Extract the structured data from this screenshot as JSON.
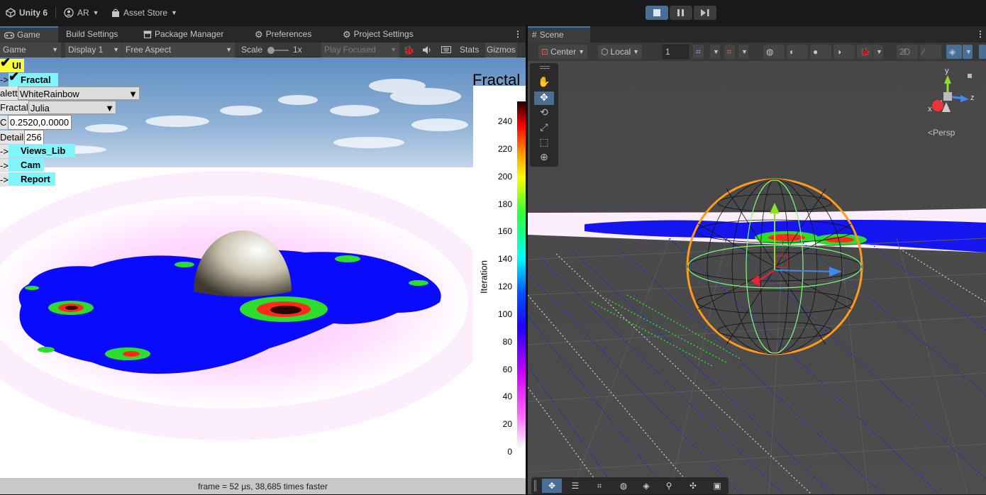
{
  "topbar": {
    "app_name": "Unity 6",
    "account": "AR",
    "asset_store": "Asset Store"
  },
  "game_tabs": [
    {
      "label": "Game"
    },
    {
      "label": "Build Settings"
    },
    {
      "label": "Package Manager"
    },
    {
      "label": "Preferences"
    },
    {
      "label": "Project Settings"
    }
  ],
  "game_toolbar": {
    "mode": "Game",
    "display": "Display 1",
    "aspect": "Free Aspect",
    "scale_label": "Scale",
    "scale_value": "1x",
    "play_mode": "Play Focused",
    "stats": "Stats",
    "gizmos": "Gizmos"
  },
  "overlay_ui": {
    "ui_toggle": "UI",
    "fractal_toggle": "Fractal",
    "palette_label": "alett",
    "palette_value": "WhiteRainbow",
    "fractal_label": "Fractal",
    "fractal_value": "Julia",
    "c_label": "C",
    "c_value": "0.2520,0.0000",
    "detail_label": "Detail",
    "detail_value": "256",
    "arrow": "->",
    "views_lib": "Views_Lib",
    "cam": "Cam",
    "report": "Report"
  },
  "colorbar": {
    "title": "Fractal",
    "axis_label": "Iteration",
    "ticks": [
      "240",
      "220",
      "200",
      "180",
      "160",
      "140",
      "120",
      "100",
      "80",
      "60",
      "40",
      "20",
      "0"
    ]
  },
  "status": {
    "text": "frame = 52 μs, 38,685 times faster"
  },
  "scene_tabs": [
    {
      "label": "Scene"
    }
  ],
  "scene_toolbar": {
    "pivot": "Center",
    "space": "Local",
    "grid_value": "1"
  },
  "gizmo": {
    "persp_label": "<Persp",
    "axis_x": "x",
    "axis_y": "y",
    "axis_z": "z"
  },
  "colors": {
    "accent": "#3a79bb",
    "cyan_label": "#7ff6fb",
    "yellow_label": "#ffff33",
    "fractal_blue": "#0a0aff",
    "fractal_green": "#2ddc2d",
    "fractal_red": "#ff2a1a"
  }
}
